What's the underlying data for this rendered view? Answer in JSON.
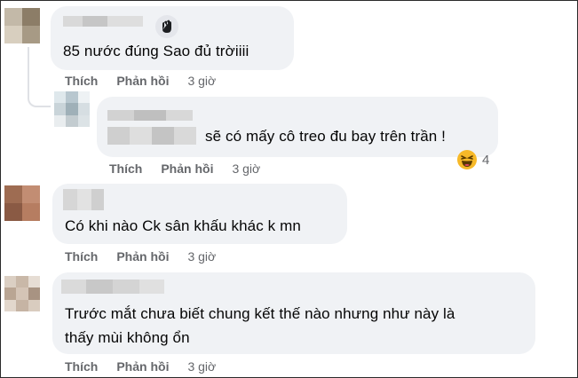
{
  "labels": {
    "like": "Thích",
    "reply": "Phản hồi"
  },
  "comments": [
    {
      "text": "85 nước đúng Sao đủ trờiiii",
      "time": "3 giờ"
    },
    {
      "text": "sẽ có mấy cô treo đu bay trên trần !",
      "time": "3 giờ",
      "reaction": {
        "emoji": "laughing-face",
        "count": "4"
      }
    },
    {
      "text": "Có khi nào Ck sân khấu khác k mn",
      "time": "3 giờ"
    },
    {
      "text_line1": "Trước mắt chưa biết chung kết thế nào nhưng như này là",
      "text_line2": "thấy mùi không ổn",
      "time": "3 giờ"
    }
  ],
  "colors": {
    "bubble": "#f0f2f5",
    "meta_text": "#65676b",
    "text": "#050505",
    "reaction_yellow": "#f7b928"
  }
}
